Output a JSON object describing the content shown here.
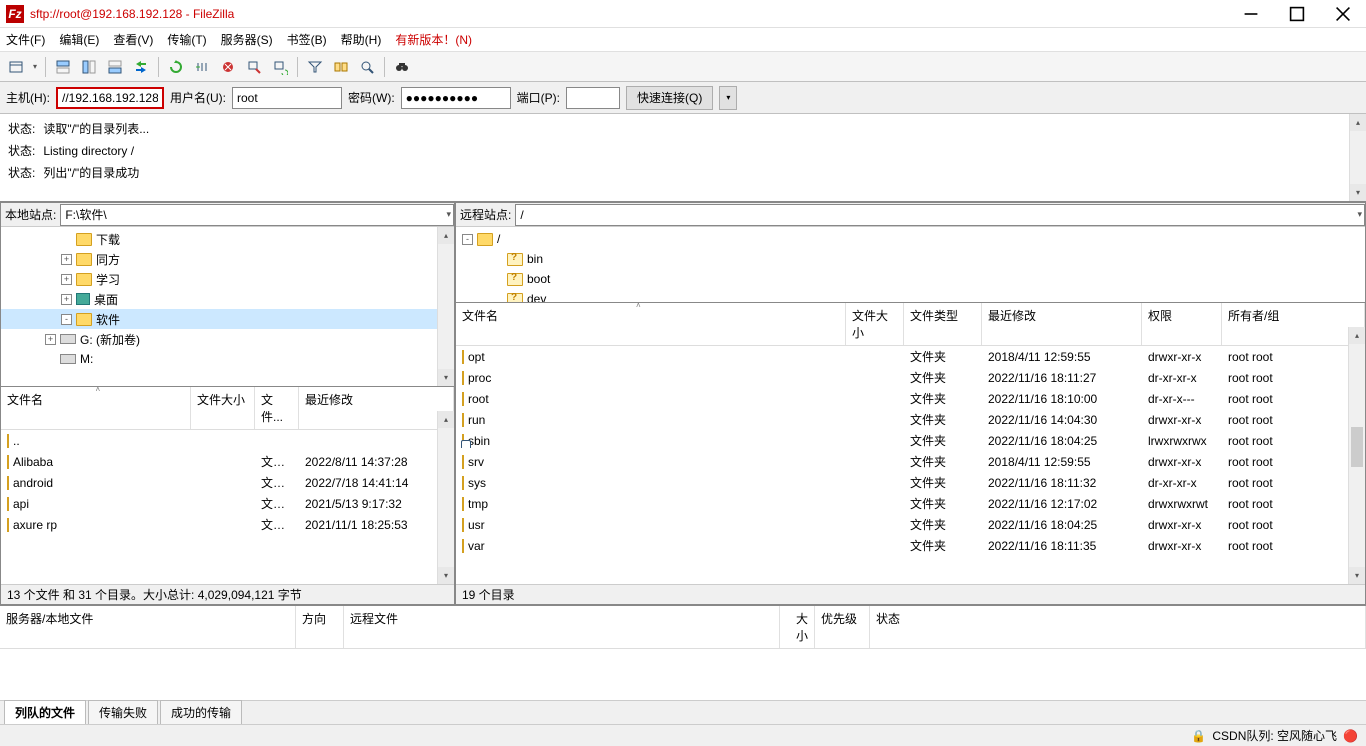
{
  "title": "sftp://root@192.168.192.128 - FileZilla",
  "menu": {
    "file": "文件(F)",
    "edit": "编辑(E)",
    "view": "查看(V)",
    "transfer": "传输(T)",
    "server": "服务器(S)",
    "bookmarks": "书签(B)",
    "help": "帮助(H)",
    "newver": "有新版本！(N)"
  },
  "quick": {
    "host_lbl": "主机(H):",
    "host": "//192.168.192.128",
    "user_lbl": "用户名(U):",
    "user": "root",
    "pass_lbl": "密码(W):",
    "pass": "●●●●●●●●●●",
    "port_lbl": "端口(P):",
    "port": "",
    "connect": "快速连接(Q)"
  },
  "log": [
    {
      "label": "状态:",
      "text": "读取\"/\"的目录列表..."
    },
    {
      "label": "状态:",
      "text": "Listing directory /"
    },
    {
      "label": "状态:",
      "text": "列出\"/\"的目录成功"
    }
  ],
  "local": {
    "site_lbl": "本地站点:",
    "site_path": "F:\\软件\\",
    "tree": [
      {
        "indent": 60,
        "exp": "",
        "ico": "folder",
        "name": "下载"
      },
      {
        "indent": 60,
        "exp": "+",
        "ico": "folder",
        "name": "同方"
      },
      {
        "indent": 60,
        "exp": "+",
        "ico": "folder",
        "name": "学习"
      },
      {
        "indent": 60,
        "exp": "+",
        "ico": "desk",
        "name": "桌面"
      },
      {
        "indent": 60,
        "exp": "-",
        "ico": "folder",
        "name": "软件",
        "sel": true
      },
      {
        "indent": 44,
        "exp": "+",
        "ico": "drive",
        "name": "G: (新加卷)"
      },
      {
        "indent": 44,
        "exp": "",
        "ico": "drive",
        "name": "M:"
      }
    ],
    "cols": {
      "name": "文件名",
      "size": "文件大小",
      "type": "文件...",
      "mod": "最近修改"
    },
    "files": [
      {
        "name": "..",
        "size": "",
        "type": "",
        "mod": ""
      },
      {
        "name": "Alibaba",
        "size": "",
        "type": "文件...",
        "mod": "2022/8/11 14:37:28"
      },
      {
        "name": "android",
        "size": "",
        "type": "文件...",
        "mod": "2022/7/18 14:41:14"
      },
      {
        "name": "api",
        "size": "",
        "type": "文件...",
        "mod": "2021/5/13 9:17:32"
      },
      {
        "name": "axure rp",
        "size": "",
        "type": "文件...",
        "mod": "2021/11/1 18:25:53"
      }
    ],
    "status": "13 个文件 和 31 个目录。大小总计: 4,029,094,121 字节"
  },
  "remote": {
    "site_lbl": "远程站点:",
    "site_path": "/",
    "tree": [
      {
        "indent": 6,
        "exp": "-",
        "ico": "folder",
        "name": "/"
      },
      {
        "indent": 36,
        "exp": "",
        "ico": "folderq",
        "name": "bin"
      },
      {
        "indent": 36,
        "exp": "",
        "ico": "folderq",
        "name": "boot"
      },
      {
        "indent": 36,
        "exp": "",
        "ico": "folderq",
        "name": "dev"
      }
    ],
    "cols": {
      "name": "文件名",
      "size": "文件大小",
      "type": "文件类型",
      "mod": "最近修改",
      "perm": "权限",
      "owner": "所有者/组"
    },
    "files": [
      {
        "name": "opt",
        "type": "文件夹",
        "mod": "2018/4/11 12:59:55",
        "perm": "drwxr-xr-x",
        "owner": "root root"
      },
      {
        "name": "proc",
        "type": "文件夹",
        "mod": "2022/11/16 18:11:27",
        "perm": "dr-xr-xr-x",
        "owner": "root root"
      },
      {
        "name": "root",
        "type": "文件夹",
        "mod": "2022/11/16 18:10:00",
        "perm": "dr-xr-x---",
        "owner": "root root"
      },
      {
        "name": "run",
        "type": "文件夹",
        "mod": "2022/11/16 14:04:30",
        "perm": "drwxr-xr-x",
        "owner": "root root"
      },
      {
        "name": "sbin",
        "type": "文件夹",
        "mod": "2022/11/16 18:04:25",
        "perm": "lrwxrwxrwx",
        "owner": "root root",
        "link": true
      },
      {
        "name": "srv",
        "type": "文件夹",
        "mod": "2018/4/11 12:59:55",
        "perm": "drwxr-xr-x",
        "owner": "root root"
      },
      {
        "name": "sys",
        "type": "文件夹",
        "mod": "2022/11/16 18:11:32",
        "perm": "dr-xr-xr-x",
        "owner": "root root"
      },
      {
        "name": "tmp",
        "type": "文件夹",
        "mod": "2022/11/16 12:17:02",
        "perm": "drwxrwxrwt",
        "owner": "root root"
      },
      {
        "name": "usr",
        "type": "文件夹",
        "mod": "2022/11/16 18:04:25",
        "perm": "drwxr-xr-x",
        "owner": "root root"
      },
      {
        "name": "var",
        "type": "文件夹",
        "mod": "2022/11/16 18:11:35",
        "perm": "drwxr-xr-x",
        "owner": "root root"
      }
    ],
    "status": "19 个目录"
  },
  "queue": {
    "cols": {
      "local": "服务器/本地文件",
      "dir": "方向",
      "remote": "远程文件",
      "size": "大小",
      "prio": "优先级",
      "status": "状态"
    }
  },
  "tabs": {
    "queued": "列队的文件",
    "failed": "传输失败",
    "success": "成功的传输"
  },
  "footer": {
    "text": "CSDN队列: 空风随心飞",
    "lock": "🔒",
    "dot": "🔴"
  }
}
